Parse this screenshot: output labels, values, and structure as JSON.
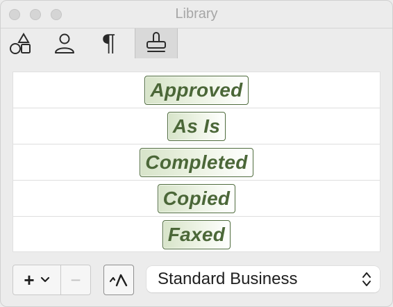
{
  "window": {
    "title": "Library"
  },
  "toolbar": {
    "items": [
      {
        "icon": "shapes-icon"
      },
      {
        "icon": "person-icon"
      },
      {
        "icon": "paragraph-icon",
        "glyph": "¶"
      },
      {
        "icon": "stamp-icon",
        "selected": true
      }
    ]
  },
  "stamps": [
    {
      "label": "Approved"
    },
    {
      "label": "As Is"
    },
    {
      "label": "Completed"
    },
    {
      "label": "Copied"
    },
    {
      "label": "Faxed"
    }
  ],
  "bottom": {
    "add_glyph": "+",
    "remove_glyph": "−",
    "set_selector": {
      "value": "Standard Business"
    }
  },
  "colors": {
    "stamp_text": "#4b6738",
    "stamp_border": "#4e6b3c",
    "stamp_fill": "#d7e4c9"
  }
}
